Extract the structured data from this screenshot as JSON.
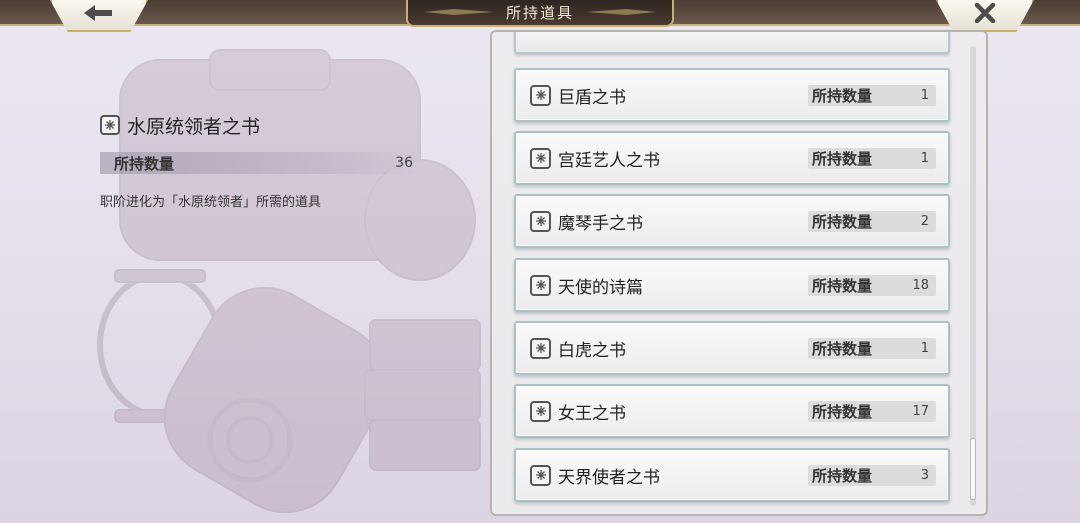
{
  "header": {
    "title": "所持道具",
    "back_icon": "arrow-left-icon",
    "close_icon": "close-x-icon"
  },
  "detail": {
    "name": "水原统领者之书",
    "qty_label": "所持数量",
    "qty_value": "36",
    "description": "职阶进化为「水原统领者」所需的道具"
  },
  "list": {
    "qty_label": "所持数量",
    "items": [
      {
        "name": "巨盾之书",
        "qty": "1"
      },
      {
        "name": "宫廷艺人之书",
        "qty": "1"
      },
      {
        "name": "魔琴手之书",
        "qty": "2"
      },
      {
        "name": "天使的诗篇",
        "qty": "18"
      },
      {
        "name": "白虎之书",
        "qty": "1"
      },
      {
        "name": "女王之书",
        "qty": "17"
      },
      {
        "name": "天界使者之书",
        "qty": "3"
      }
    ]
  },
  "colors": {
    "frame_gold": "#c9b06a",
    "row_border": "#a9c0c9",
    "title_plate": "#2d2520"
  }
}
